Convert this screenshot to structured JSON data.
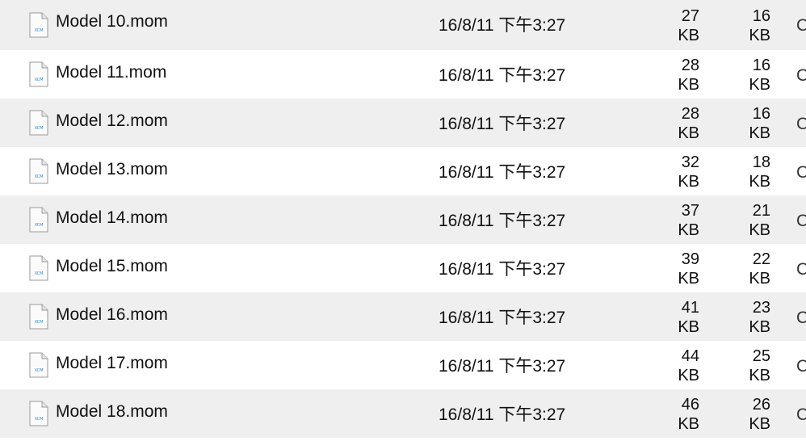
{
  "file_list": {
    "rows": [
      {
        "name": "Model 10.mom",
        "date": "16/8/11 下午3:27",
        "size_a_num": "27",
        "size_a_unit": "KB",
        "size_b_num": "16",
        "size_b_unit": "KB",
        "kind": "C"
      },
      {
        "name": "Model 11.mom",
        "date": "16/8/11 下午3:27",
        "size_a_num": "28",
        "size_a_unit": "KB",
        "size_b_num": "16",
        "size_b_unit": "KB",
        "kind": "C"
      },
      {
        "name": "Model 12.mom",
        "date": "16/8/11 下午3:27",
        "size_a_num": "28",
        "size_a_unit": "KB",
        "size_b_num": "16",
        "size_b_unit": "KB",
        "kind": "C"
      },
      {
        "name": "Model 13.mom",
        "date": "16/8/11 下午3:27",
        "size_a_num": "32",
        "size_a_unit": "KB",
        "size_b_num": "18",
        "size_b_unit": "KB",
        "kind": "C"
      },
      {
        "name": "Model 14.mom",
        "date": "16/8/11 下午3:27",
        "size_a_num": "37",
        "size_a_unit": "KB",
        "size_b_num": "21",
        "size_b_unit": "KB",
        "kind": "C"
      },
      {
        "name": "Model 15.mom",
        "date": "16/8/11 下午3:27",
        "size_a_num": "39",
        "size_a_unit": "KB",
        "size_b_num": "22",
        "size_b_unit": "KB",
        "kind": "C"
      },
      {
        "name": "Model 16.mom",
        "date": "16/8/11 下午3:27",
        "size_a_num": "41",
        "size_a_unit": "KB",
        "size_b_num": "23",
        "size_b_unit": "KB",
        "kind": "C"
      },
      {
        "name": "Model 17.mom",
        "date": "16/8/11 下午3:27",
        "size_a_num": "44",
        "size_a_unit": "KB",
        "size_b_num": "25",
        "size_b_unit": "KB",
        "kind": "C"
      },
      {
        "name": "Model 18.mom",
        "date": "16/8/11 下午3:27",
        "size_a_num": "46",
        "size_a_unit": "KB",
        "size_b_num": "26",
        "size_b_unit": "KB",
        "kind": "C"
      }
    ],
    "icon": "document-file-icon",
    "icon_badge_label": "XCM",
    "colors": {
      "alt_row_bg": "#efefef",
      "row_bg": "#ffffff",
      "icon_badge": "#2f7fd6"
    }
  }
}
